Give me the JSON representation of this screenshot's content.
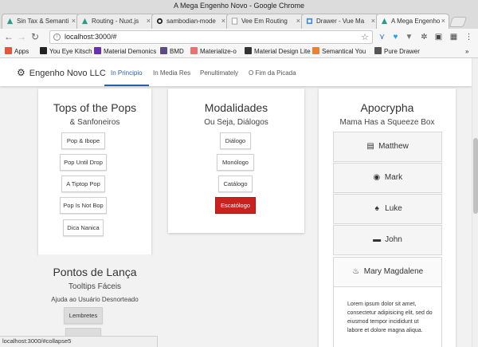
{
  "window": {
    "title": "A Mega Engenho Novo - Google Chrome"
  },
  "tabs": [
    {
      "label": "Sin Tax & Semanti",
      "favicon_color": "#2b9a8a"
    },
    {
      "label": "Routing - Nuxt.js",
      "favicon_color": "#2b9a8a"
    },
    {
      "label": "sambodian-mode",
      "favicon_color": "#222222"
    },
    {
      "label": "Vee Em Routing",
      "favicon_color": "#ffffff"
    },
    {
      "label": "Drawer - Vue Ma",
      "favicon_color": "#4a90d9"
    },
    {
      "label": "A Mega Engenho",
      "favicon_color": "#2b9a8a"
    }
  ],
  "toolbar": {
    "url": "localhost:3000/#",
    "back_icon": "arrow-left",
    "forward_icon": "arrow-right",
    "reload_icon": "reload",
    "home_icon": "home"
  },
  "bookmarks": [
    {
      "label": "Apps",
      "color": "#e8553d"
    },
    {
      "label": "You Eye Kitsch",
      "color": "#222222"
    },
    {
      "label": "Material Demonics",
      "color": "#6a2fb8"
    },
    {
      "label": "BMD",
      "color": "#5b4b8a"
    },
    {
      "label": "Materialize-o",
      "color": "#ee6e73"
    },
    {
      "label": "Material Design Lite",
      "color": "#333333"
    },
    {
      "label": "Semantical You",
      "color": "#e8842a"
    },
    {
      "label": "Pure Drawer",
      "color": "#555555"
    }
  ],
  "bookmarks_more": "»",
  "appbar": {
    "brand": "Engenho Novo LLC",
    "nav": [
      "In Principio",
      "In Media Res",
      "Penultimately",
      "O Fim da Picada"
    ],
    "active_index": 0,
    "accent": "#2b5ea8"
  },
  "cards": {
    "tops": {
      "title": "Tops of the Pops",
      "subtitle": "& Sanfoneiros",
      "buttons": [
        "Pop & Ibope",
        "Pop Until Drop",
        "A Tiptop Pop",
        "Pop Is Not Bop",
        "Dica Nanica"
      ]
    },
    "modalidades": {
      "title": "Modalidades",
      "subtitle": "Ou Seja, Diálogos",
      "buttons": [
        "Diálogo",
        "Monólogo",
        "Catálogo",
        "Escatólogo"
      ],
      "danger_color": "#c9211e"
    },
    "apocrypha": {
      "title": "Apocrypha",
      "subtitle": "Mama Has a Squeeze Box",
      "items": [
        {
          "label": "Matthew",
          "icon": "newspaper-icon"
        },
        {
          "label": "Mark",
          "icon": "target-icon"
        },
        {
          "label": "Luke",
          "icon": "flame-icon"
        },
        {
          "label": "John",
          "icon": "book-icon"
        },
        {
          "label": "Mary Magdalene",
          "icon": "fire-icon"
        }
      ],
      "body": "Lorem ipsum dolor sit amet, consectetur adipisicing elit, sed do eiusmod tempor incididunt ut labore et dolore magna aliqua."
    },
    "pontos": {
      "title": "Pontos de Lança",
      "subtitle": "Tooltips Fáceis",
      "caption": "Ajuda ao Usuário Desnorteado",
      "buttons": [
        "Lembretes",
        ""
      ]
    }
  },
  "status_url": "localhost:3000/#collapse5"
}
